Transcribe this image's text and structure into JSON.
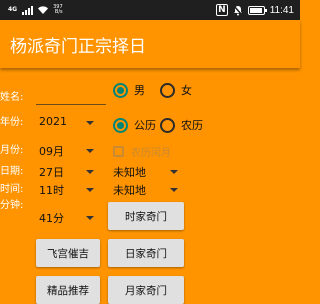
{
  "status_bar": {
    "network": "4G",
    "net_speed_value": "397",
    "net_speed_unit": "B/s",
    "nfc": "N",
    "time": "11:41",
    "icons": [
      "signal-icon",
      "wifi-icon",
      "nfc-icon",
      "mute-icon",
      "battery-icon"
    ]
  },
  "appbar": {
    "title": "杨派奇门正宗择日"
  },
  "form": {
    "name_label": "姓名:",
    "name_value": "",
    "gender_options": [
      {
        "label": "男",
        "checked": true
      },
      {
        "label": "女",
        "checked": false
      }
    ],
    "year_label": "年份:",
    "year_value": "2021",
    "calendar_options": [
      {
        "label": "公历",
        "checked": true
      },
      {
        "label": "农历",
        "checked": false
      }
    ],
    "month_label": "月份:",
    "month_value": "09月",
    "leap_month_label": "农历闰月",
    "leap_month_checked": false,
    "day_label": "日期:",
    "day_value": "27日",
    "location1_value": "未知地",
    "hour_label": "时间:",
    "hour_value": "11时",
    "location2_value": "未知地",
    "minute_label": "分钟:",
    "minute_value": "41分"
  },
  "buttons": {
    "shijia": "时家奇门",
    "feigong": "飞宫催吉",
    "rijia": "日家奇门",
    "jingpin": "精品推荐",
    "yuejia": "月家奇门"
  },
  "colors": {
    "background": "#FF9400",
    "accent": "#008577",
    "status_bar": "#1f1f1f",
    "button": "#E0E0E0"
  }
}
